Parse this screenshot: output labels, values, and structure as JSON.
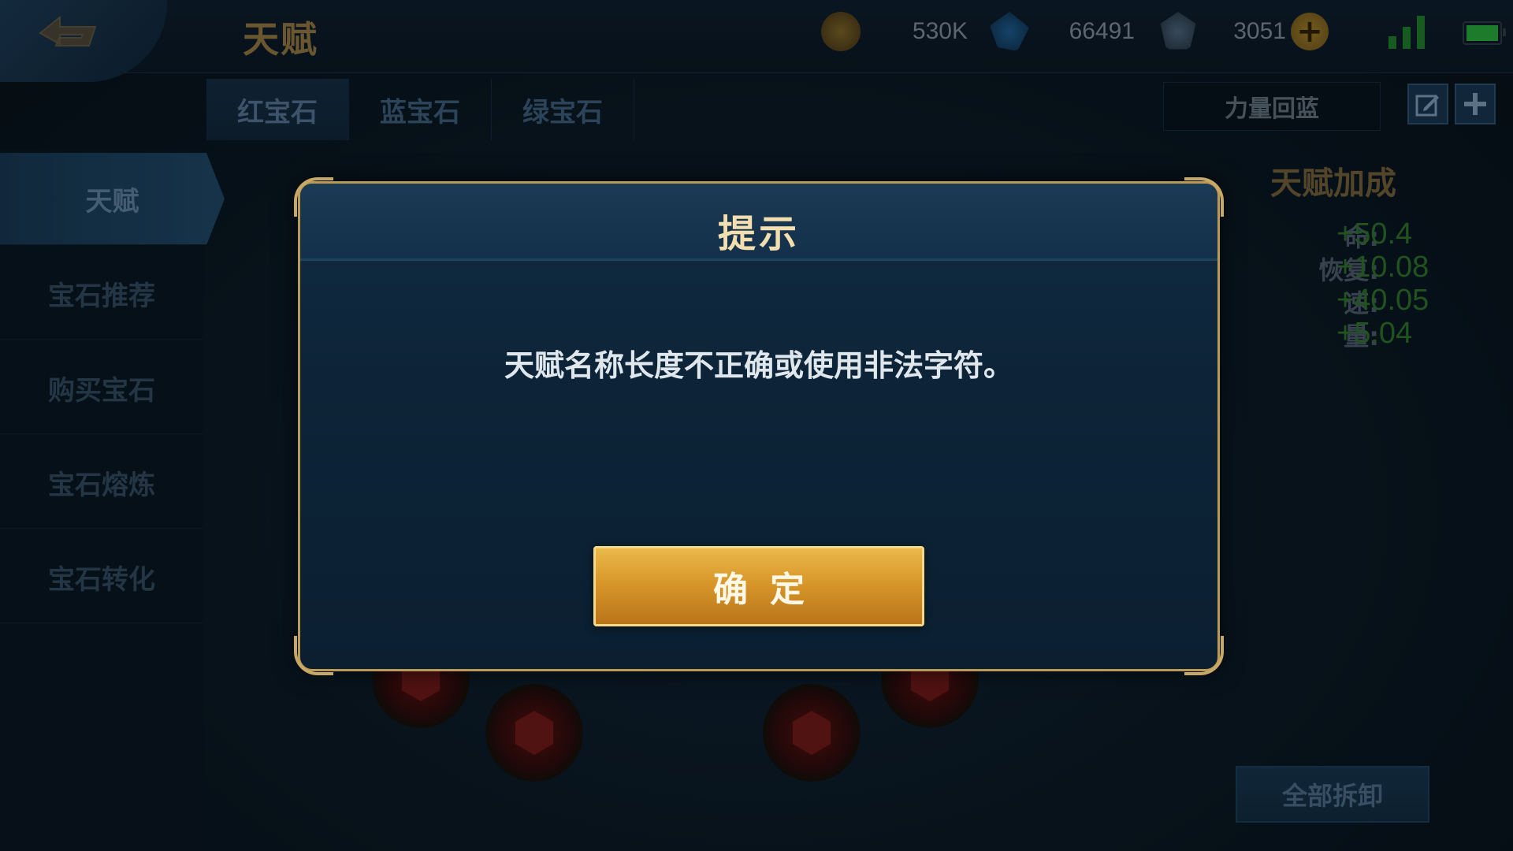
{
  "header": {
    "title": "天赋",
    "currencies": [
      {
        "name": "gold",
        "value": "530K",
        "color": "#b98b2f"
      },
      {
        "name": "diamond",
        "value": "66491",
        "color": "#3b7fc7"
      },
      {
        "name": "coupon",
        "value": "3051",
        "color": "#6c8aa6"
      }
    ],
    "add_label": "+"
  },
  "gem_tabs": [
    {
      "label": "红宝石"
    },
    {
      "label": "蓝宝石"
    },
    {
      "label": "绿宝石"
    }
  ],
  "preset_name": "力量回蓝",
  "sidebar": {
    "items": [
      {
        "label": "天赋"
      },
      {
        "label": "宝石推荐"
      },
      {
        "label": "购买宝石"
      },
      {
        "label": "宝石熔炼"
      },
      {
        "label": "宝石转化"
      }
    ]
  },
  "bonus_panel": {
    "title": "天赋加成",
    "stats": [
      {
        "label": "命:",
        "value": "+50.4"
      },
      {
        "label": "恢复:",
        "value": "+10.08"
      },
      {
        "label": "速:",
        "value": "+40.05"
      },
      {
        "label": "量:",
        "value": "+5.04"
      }
    ],
    "unload_all_label": "全部拆卸"
  },
  "dialog": {
    "title": "提示",
    "message": "天赋名称长度不正确或使用非法字符。",
    "confirm_label": "确定"
  }
}
